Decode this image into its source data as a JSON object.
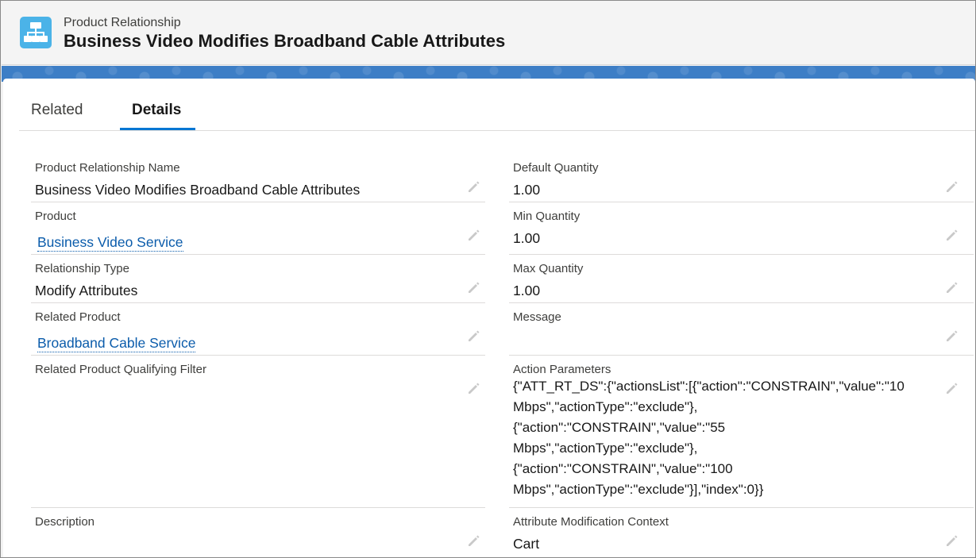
{
  "header": {
    "object_type": "Product Relationship",
    "record_title": "Business Video Modifies Broadband Cable Attributes",
    "icon": "hierarchy-icon",
    "icon_color": "#4bb3e8"
  },
  "tabs": [
    {
      "label": "Related",
      "active": false
    },
    {
      "label": "Details",
      "active": true
    }
  ],
  "accent_color": "#0176d3",
  "link_color": "#0b5cab",
  "fields": {
    "product_relationship_name": {
      "label": "Product Relationship Name",
      "value": "Business Video Modifies Broadband Cable Attributes"
    },
    "product": {
      "label": "Product",
      "value": "Business Video Service"
    },
    "relationship_type": {
      "label": "Relationship Type",
      "value": "Modify Attributes"
    },
    "related_product": {
      "label": "Related Product",
      "value": "Broadband Cable Service"
    },
    "related_product_qualifying_filter": {
      "label": "Related Product Qualifying Filter",
      "value": ""
    },
    "description": {
      "label": "Description",
      "value": ""
    },
    "default_quantity": {
      "label": "Default Quantity",
      "value": "1.00"
    },
    "min_quantity": {
      "label": "Min Quantity",
      "value": "1.00"
    },
    "max_quantity": {
      "label": "Max Quantity",
      "value": "1.00"
    },
    "message": {
      "label": "Message",
      "value": ""
    },
    "action_parameters": {
      "label": "Action Parameters",
      "lines": [
        "{\"ATT_RT_DS\":{\"actionsList\":[{\"action\":\"CONSTRAIN\",\"value\":\"10",
        "Mbps\",\"actionType\":\"exclude\"},",
        "{\"action\":\"CONSTRAIN\",\"value\":\"55",
        "Mbps\",\"actionType\":\"exclude\"},",
        "{\"action\":\"CONSTRAIN\",\"value\":\"100",
        "Mbps\",\"actionType\":\"exclude\"}],\"index\":0}}"
      ]
    },
    "attribute_modification_context": {
      "label": "Attribute Modification Context",
      "value": "Cart"
    }
  }
}
